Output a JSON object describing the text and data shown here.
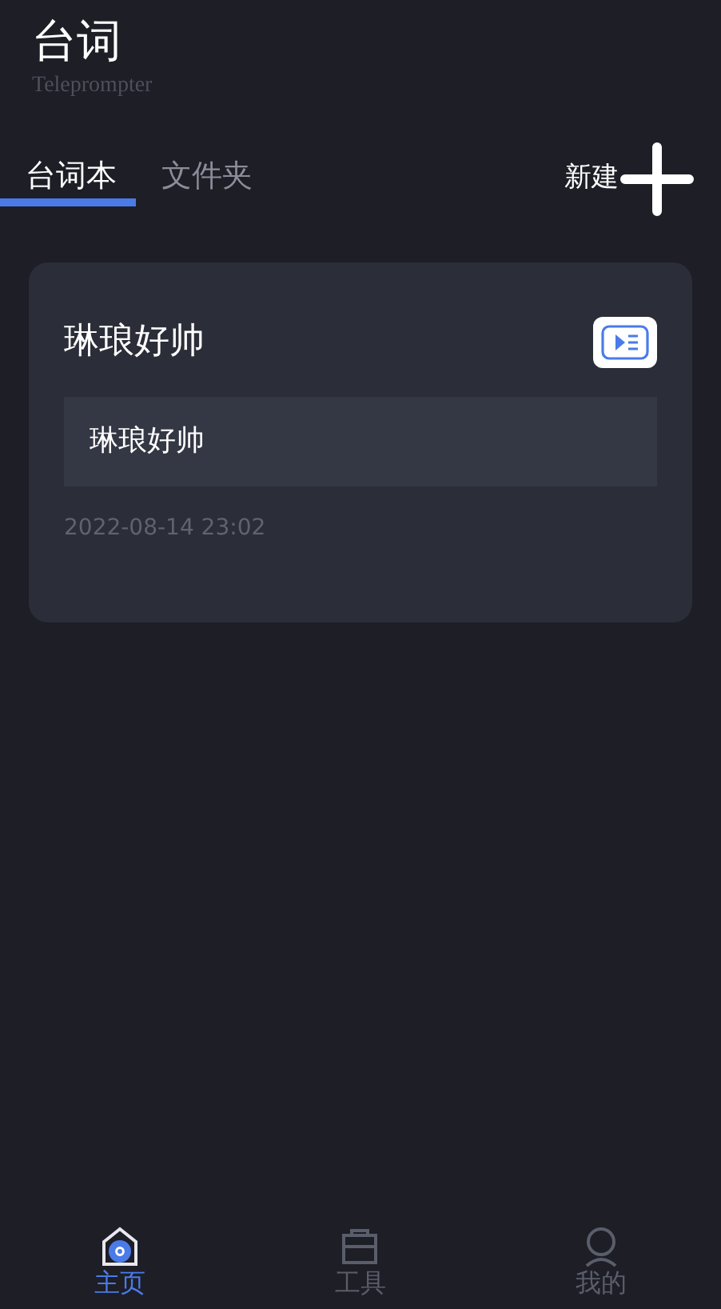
{
  "header": {
    "title": "台词",
    "subtitle": "Teleprompter"
  },
  "tabs": [
    {
      "label": "台词本",
      "selected": true
    },
    {
      "label": "文件夹",
      "selected": false
    }
  ],
  "new_button": {
    "label": "新建"
  },
  "scripts": [
    {
      "title": "琳琅好帅",
      "preview": "琳琅好帅",
      "date": "2022-08-14 23:02"
    }
  ],
  "bottom_nav": [
    {
      "label": "主页",
      "kind": "home",
      "selected": true
    },
    {
      "label": "工具",
      "kind": "tools",
      "selected": false
    },
    {
      "label": "我的",
      "kind": "profile",
      "selected": false
    }
  ]
}
